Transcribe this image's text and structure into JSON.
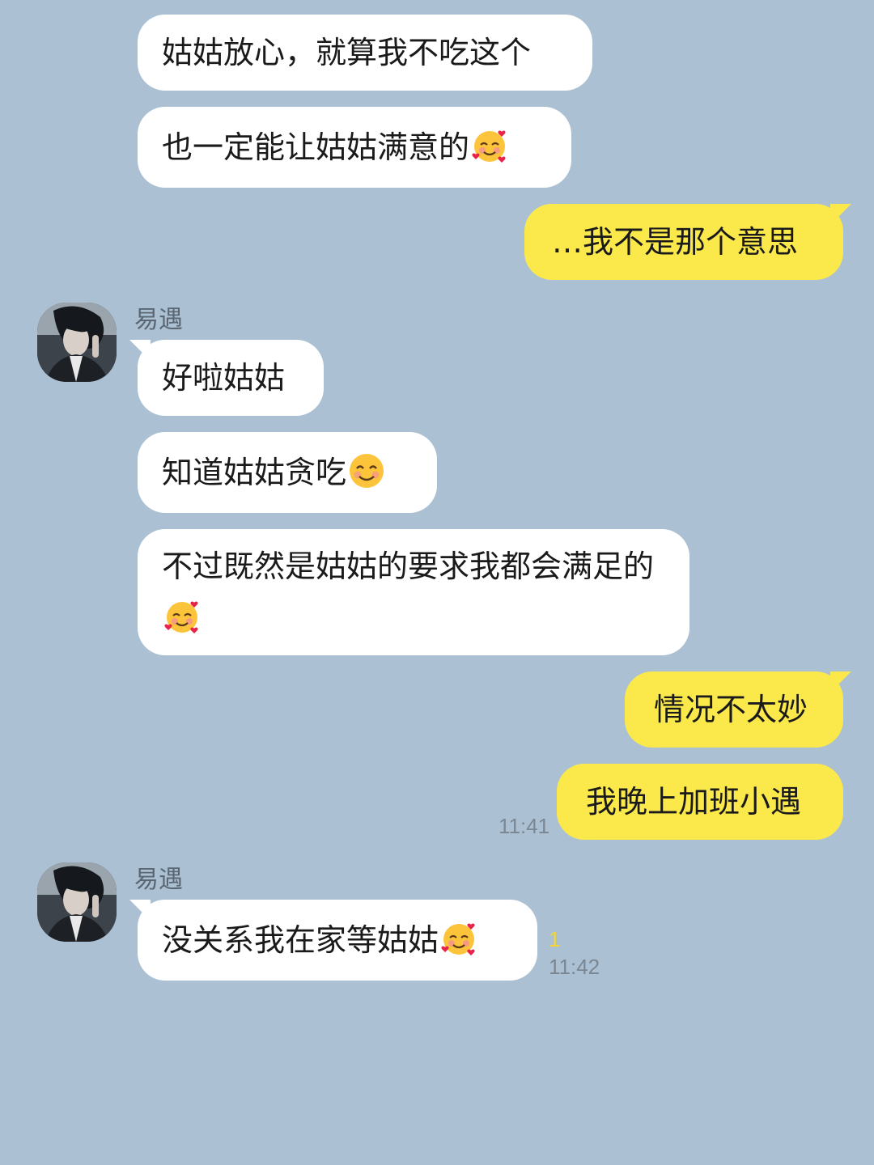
{
  "conversation": {
    "contact_name": "易遇",
    "messages": [
      {
        "side": "in",
        "text": "姑姑放心，就算我不吃这个",
        "emoji": ""
      },
      {
        "side": "in",
        "text": "也一定能让姑姑满意的",
        "emoji": "smiling-face-with-hearts"
      },
      {
        "side": "out",
        "text": "…我不是那个意思",
        "emoji": ""
      },
      {
        "side": "in",
        "sender": "易遇",
        "text": "好啦姑姑",
        "emoji": ""
      },
      {
        "side": "in",
        "text": "知道姑姑贪吃",
        "emoji": "smiling-face"
      },
      {
        "side": "in",
        "text": "不过既然是姑姑的要求我都会满足的",
        "emoji": "smiling-face-with-hearts"
      },
      {
        "side": "out",
        "text": "情况不太妙",
        "emoji": ""
      },
      {
        "side": "out",
        "text": "我晚上加班小遇",
        "emoji": "",
        "time": "11:41"
      },
      {
        "side": "in",
        "sender": "易遇",
        "text": "没关系我在家等姑姑",
        "emoji": "smiling-face-with-hearts",
        "unread": "1",
        "time": "11:42"
      }
    ]
  },
  "colors": {
    "background": "#abc1d3",
    "incoming_bubble": "#ffffff",
    "outgoing_bubble": "#fbe94c",
    "unread_count": "#f0d43a",
    "timestamp": "#7b8793"
  }
}
